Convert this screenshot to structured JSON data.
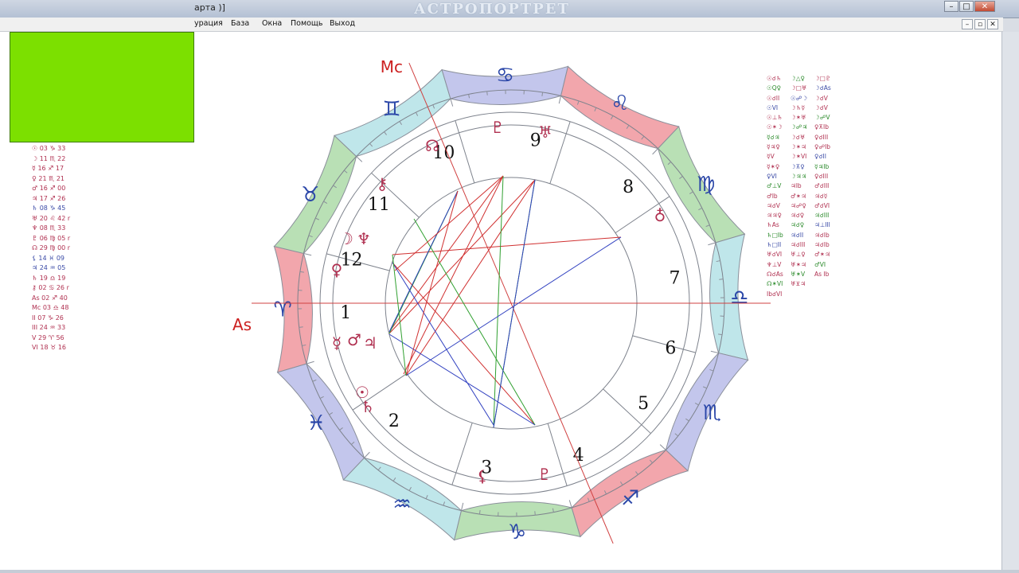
{
  "window": {
    "title": "арта )]",
    "watermark": "АСТРОПОРТРЕТ",
    "minimize": "–",
    "maximize": "□",
    "close": "✕",
    "inner_minimize": "–",
    "inner_restore": "▫",
    "inner_close": "✕"
  },
  "menu": [
    {
      "id": "config",
      "label": "урация"
    },
    {
      "id": "base",
      "label": "База"
    },
    {
      "id": "windows",
      "label": "Окна"
    },
    {
      "id": "help",
      "label": "Помощь"
    },
    {
      "id": "exit",
      "label": "Выход"
    }
  ],
  "green_box_color": "#7ce000",
  "planet_positions": [
    "☉ 03 ♑ 33",
    "☽ 11 ♏ 22",
    "☿ 16 ♐ 17",
    "♀ 21 ♏ 21",
    "♂ 16 ♐ 00",
    "♃ 17 ♐ 26",
    "♄ 08 ♑ 45",
    "♅ 20 ♌ 42 r",
    "♆ 08 ♏ 33",
    "♇ 06 ♍ 05 r",
    "☊ 29 ♍ 00 r",
    "⚸ 14 ♓ 09",
    "♃ 24 ♒ 05",
    "♄ 19 ♎ 19",
    "⚷ 02 ♋ 26 r",
    "As 02 ♐ 40",
    "Mc 03 ♎ 48",
    "II 07 ♑ 26",
    "III 24 ♒ 33",
    "V 29 ♈ 56",
    "VI 18 ♉ 16"
  ],
  "aspect_table": [
    [
      "☉☌♄",
      "☽△♀",
      "☽□♇"
    ],
    [
      "☉Q♀",
      "☽□♅",
      "☽☌As"
    ],
    [
      "☉☌II",
      "☉☍☽",
      "☽☌V"
    ],
    [
      "☉VI",
      "☽♄☿",
      "☽☌V"
    ],
    [
      "☉⊥♄",
      "☽✶♅",
      "☽☍V"
    ],
    [
      "☉✶☽",
      "☽☍♃",
      "♀⊼Ib"
    ],
    [
      "☿☌♃",
      "☽☌♅",
      "♀☌III"
    ],
    [
      "☿♃♀",
      "☽✶♃",
      "♀☍Ib"
    ],
    [
      "☿V",
      "☽✶VI",
      "♀☌II"
    ],
    [
      "☿✶♀",
      "☽⊼♀",
      "☿♃Ib"
    ],
    [
      "♀VI",
      "☽♃♃",
      "♀☌III"
    ],
    [
      "♂⊥V",
      "♃Ib",
      "♂☌III"
    ],
    [
      "♂Ib",
      "♂✶♃",
      "♃☌☿"
    ],
    [
      "♃☌V",
      "♃☍♀",
      "♂☌VI"
    ],
    [
      "♃♃♀",
      "♃☌♀",
      "♃☌III"
    ],
    [
      "♄As",
      "♃☌♀",
      "♃⊥III"
    ],
    [
      "♄□Ib",
      "♃☌II",
      "♃☌Ib"
    ],
    [
      "♄□II",
      "♃☌III",
      "♃☌Ib"
    ],
    [
      "♅☌VI",
      "♅⊥♀",
      "♂✶♃"
    ],
    [
      "♆⊥V",
      "♅✶♃",
      "♂VI"
    ],
    [
      "☊☌As",
      "♅✶V",
      "As Ib"
    ],
    [
      "☊✶VI",
      "♅⊻♃",
      ""
    ],
    [
      "Ib☌VI",
      "",
      ""
    ]
  ],
  "chart": {
    "signs": [
      {
        "name": "aries",
        "glyph": "♈",
        "color": "#f2a6ac"
      },
      {
        "name": "taurus",
        "glyph": "♉",
        "color": "#b9e0b5"
      },
      {
        "name": "gemini",
        "glyph": "♊",
        "color": "#bfe6ea"
      },
      {
        "name": "cancer",
        "glyph": "♋",
        "color": "#c3c6ec"
      },
      {
        "name": "leo",
        "glyph": "♌",
        "color": "#f2a6ac"
      },
      {
        "name": "virgo",
        "glyph": "♍",
        "color": "#b9e0b5"
      },
      {
        "name": "libra",
        "glyph": "♎",
        "color": "#bfe6ea"
      },
      {
        "name": "scorpio",
        "glyph": "♏",
        "color": "#c3c6ec"
      },
      {
        "name": "sagittarius",
        "glyph": "♐",
        "color": "#f2a6ac"
      },
      {
        "name": "capricorn",
        "glyph": "♑",
        "color": "#b9e0b5"
      },
      {
        "name": "aquarius",
        "glyph": "♒",
        "color": "#bfe6ea"
      },
      {
        "name": "pisces",
        "glyph": "♓",
        "color": "#c3c6ec"
      }
    ],
    "ascendant_label": "As",
    "midheaven_label": "Mc",
    "house_numbers": [
      "1",
      "2",
      "3",
      "4",
      "5",
      "6",
      "7",
      "8",
      "9",
      "10",
      "11",
      "12"
    ],
    "planets": [
      {
        "name": "sun",
        "glyph": "☉"
      },
      {
        "name": "moon",
        "glyph": "☽"
      },
      {
        "name": "mercury",
        "glyph": "☿"
      },
      {
        "name": "venus",
        "glyph": "♀"
      },
      {
        "name": "mars",
        "glyph": "♂"
      },
      {
        "name": "jupiter",
        "glyph": "♃"
      },
      {
        "name": "saturn",
        "glyph": "♄"
      },
      {
        "name": "uranus",
        "glyph": "♅"
      },
      {
        "name": "neptune",
        "glyph": "♆"
      },
      {
        "name": "pluto",
        "glyph": "♇"
      },
      {
        "name": "node",
        "glyph": "☊"
      },
      {
        "name": "lilith",
        "glyph": "⚸"
      },
      {
        "name": "chiron",
        "glyph": "⚷"
      },
      {
        "name": "selena",
        "glyph": "♁"
      },
      {
        "name": "proserpina",
        "glyph": "♇"
      },
      {
        "name": "lilith-2",
        "glyph": "⚸"
      },
      {
        "name": "pars-fortuna",
        "glyph": "⊕"
      },
      {
        "name": "transpluto",
        "glyph": "♆"
      }
    ]
  }
}
